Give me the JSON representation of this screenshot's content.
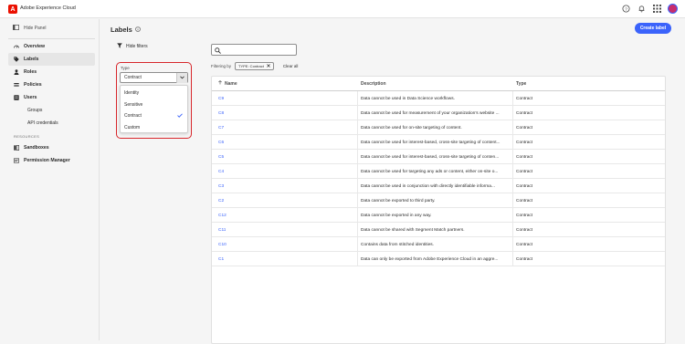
{
  "topbar": {
    "app_title": "Adobe Experience Cloud",
    "logo_letter": "A",
    "icons": [
      "help-icon",
      "bell-icon",
      "apps-grid-icon",
      "avatar"
    ]
  },
  "sidebar": {
    "hide_panel_label": "Hide Panel",
    "items": [
      {
        "label": "Overview",
        "icon": "overview-icon"
      },
      {
        "label": "Labels",
        "icon": "tag-icon",
        "active": true
      },
      {
        "label": "Roles",
        "icon": "person-icon"
      },
      {
        "label": "Policies",
        "icon": "policy-icon"
      },
      {
        "label": "Users",
        "icon": "users-icon"
      }
    ],
    "subitems": [
      {
        "label": "Groups"
      },
      {
        "label": "API credentials"
      }
    ],
    "resources_heading": "RESOURCES",
    "resources": [
      {
        "label": "Sandboxes",
        "icon": "sandbox-icon"
      },
      {
        "label": "Permission Manager",
        "icon": "permission-icon"
      }
    ]
  },
  "main": {
    "title": "Labels",
    "create_button": "Create label",
    "hide_filters_label": "Hide filters",
    "type_label": "Type",
    "type_selected": "Contract",
    "type_options": [
      {
        "label": "Identity",
        "checked": false
      },
      {
        "label": "Sensitive",
        "checked": false
      },
      {
        "label": "Contract",
        "checked": true
      },
      {
        "label": "Custom",
        "checked": false
      }
    ],
    "search_placeholder": "",
    "filtering_by_label": "Filtering by",
    "chip_label": "TYPE: Contract",
    "clear_all": "Clear all",
    "columns": {
      "name": "Name",
      "description": "Description",
      "type": "Type"
    },
    "rows": [
      {
        "name": "C9",
        "description": "Data cannot be used in Data Science workflows.",
        "type": "Contract"
      },
      {
        "name": "C8",
        "description": "Data cannot be used for measurement of your organization’s website ...",
        "type": "Contract"
      },
      {
        "name": "C7",
        "description": "Data cannot be used for on-site targeting of content.",
        "type": "Contract"
      },
      {
        "name": "C6",
        "description": "Data cannot be used for interest-based, cross-site targeting of content...",
        "type": "Contract"
      },
      {
        "name": "C5",
        "description": "Data cannot be used for interest-based, cross-site targeting of conten...",
        "type": "Contract"
      },
      {
        "name": "C4",
        "description": "Data cannot be used for targeting any ads or content, either on-site o...",
        "type": "Contract"
      },
      {
        "name": "C3",
        "description": "Data cannot be used in conjunction with directly identifiable informa...",
        "type": "Contract"
      },
      {
        "name": "C2",
        "description": "Data cannot be exported to third party.",
        "type": "Contract"
      },
      {
        "name": "C12",
        "description": "Data cannot be exported in any way.",
        "type": "Contract"
      },
      {
        "name": "C11",
        "description": "Data cannot be shared with Segment Match partners.",
        "type": "Contract"
      },
      {
        "name": "C10",
        "description": "Contains data from stitched identities.",
        "type": "Contract"
      },
      {
        "name": "C1",
        "description": "Data can only be exported from Adobe Experience Cloud in an aggre...",
        "type": "Contract"
      }
    ]
  },
  "colors": {
    "accent": "#3b63fb",
    "brand": "#eb1000",
    "highlight": "#d7262b"
  }
}
